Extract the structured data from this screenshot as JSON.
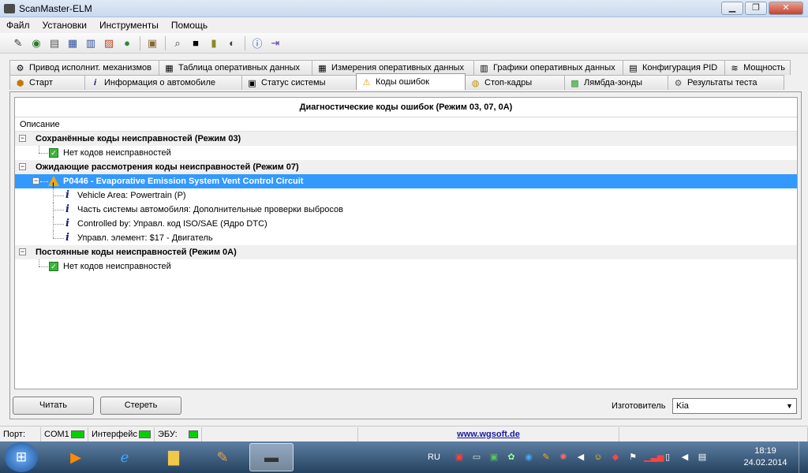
{
  "window": {
    "title": "ScanMaster-ELM",
    "minimize": "▁",
    "maximize": "❐",
    "close": "✕"
  },
  "menu": [
    "Файл",
    "Установки",
    "Инструменты",
    "Помощь"
  ],
  "tabs_row1": [
    {
      "label": "Привод исполнит. механизмов",
      "icon": "⚙"
    },
    {
      "label": "Таблица оперативных данных",
      "icon": "▦"
    },
    {
      "label": "Измерения оперативных данных",
      "icon": "▦"
    },
    {
      "label": "Графики оперативных данных",
      "icon": "▥"
    },
    {
      "label": "Конфигурация PID",
      "icon": "▤"
    },
    {
      "label": "Мощность",
      "icon": "≋"
    }
  ],
  "tabs_row2": [
    {
      "label": "Старт",
      "icon": "⬢"
    },
    {
      "label": "Информация о автомобиле",
      "icon": "i"
    },
    {
      "label": "Статус системы",
      "icon": "▣"
    },
    {
      "label": "Коды ошибок",
      "icon": "⚠",
      "active": true
    },
    {
      "label": "Стоп-кадры",
      "icon": "◍"
    },
    {
      "label": "Лямбда-зонды",
      "icon": "▩"
    },
    {
      "label": "Результаты теста",
      "icon": "⚙"
    }
  ],
  "grid": {
    "title": "Диагностические коды ошибок (Режим 03, 07, 0A)",
    "column": "Описание",
    "group1": "Сохранённые коды неисправностей (Режим 03)",
    "group1_item": "Нет кодов неисправностей",
    "group2": "Ожидающие рассмотрения коды неисправностей (Режим 07)",
    "dtc": "P0446 - Evaporative Emission System Vent Control Circuit",
    "dtc_details": [
      "Vehicle Area: Powertrain (P)",
      "Часть системы автомобиля: Дополнительные проверки выбросов",
      "Controlled by: Управл. код ISO/SAE  (Ядро DTC)",
      "Управл. элемент: $17 - Двигатель"
    ],
    "group3": "Постоянные коды неисправностей  (Режим 0A)",
    "group3_item": "Нет кодов неисправностей"
  },
  "buttons": {
    "read": "Читать",
    "clear": "Стереть"
  },
  "manufacturer": {
    "label": "Изготовитель",
    "value": "Kia"
  },
  "status": {
    "port_label": "Порт:",
    "port_value": "COM1",
    "interface_label": "Интерфейс",
    "ecu_label": "ЭБУ:",
    "link": "www.wgsoft.de"
  },
  "taskbar": {
    "lang": "RU",
    "time": "18:19",
    "date": "24.02.2014"
  }
}
